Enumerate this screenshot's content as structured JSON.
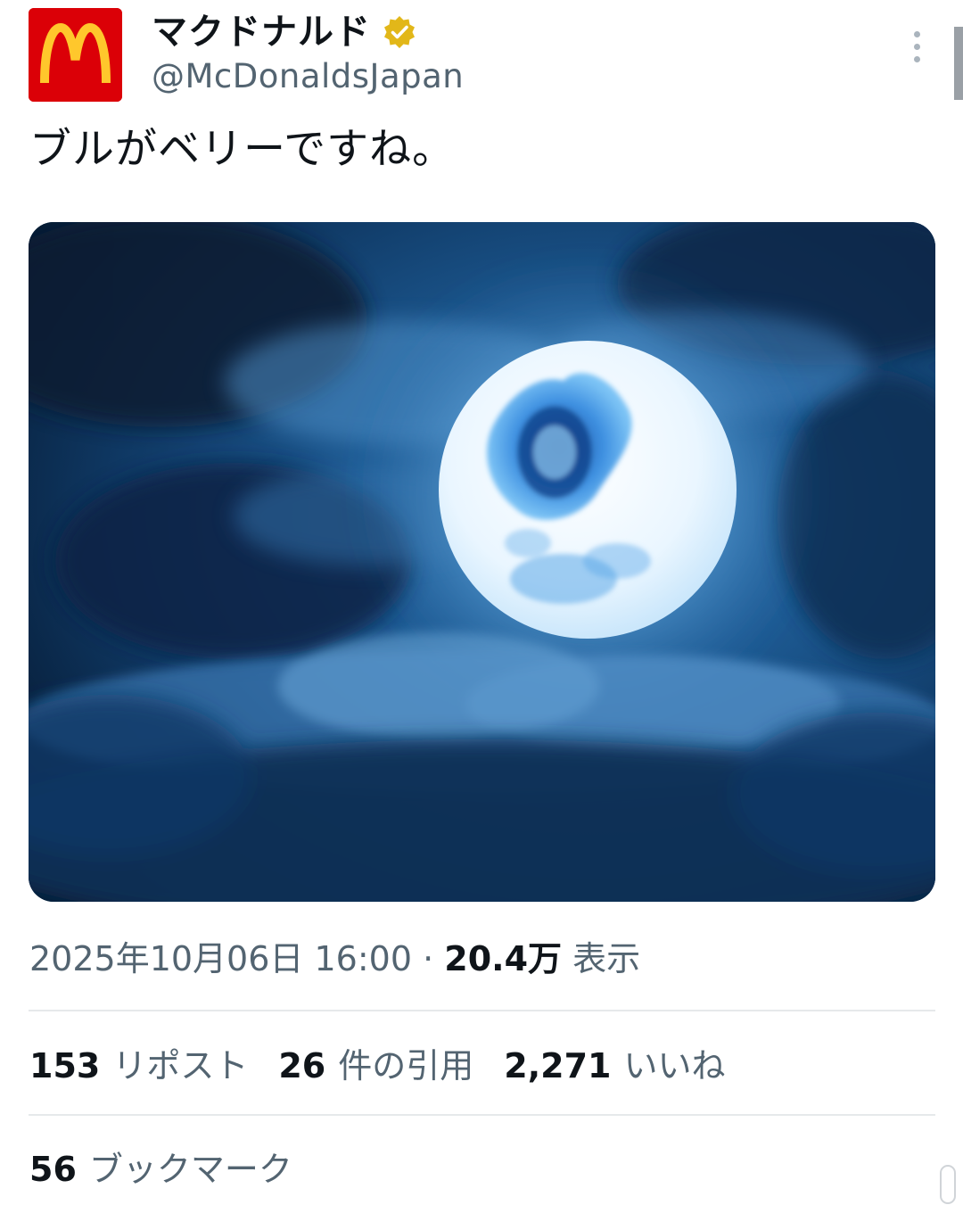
{
  "author": {
    "display_name": "マクドナルド",
    "handle": "@McDonaldsJapan",
    "verified_icon": "verified-badge-icon",
    "avatar_icon": "mcdonalds-logo-icon",
    "brand_red": "#db0007",
    "brand_yellow": "#ffc72c",
    "badge_color": "#e2b719"
  },
  "tweet": {
    "text": "ブルがベリーですね。",
    "media_alt_icon": "full-moon-image"
  },
  "meta": {
    "timestamp": "2025年10月06日 16:00",
    "separator": "·",
    "views_count": "20.4万",
    "views_label": "表示"
  },
  "stats": {
    "retweets": {
      "count": "153",
      "label": "リポスト"
    },
    "quotes": {
      "count": "26",
      "label": "件の引用"
    },
    "likes": {
      "count": "2,271",
      "label": "いいね"
    },
    "bookmarks": {
      "count": "56",
      "label": "ブックマーク"
    }
  },
  "colors": {
    "text_primary": "#0f1419",
    "text_secondary": "#536471",
    "divider": "#e6e9eb"
  }
}
